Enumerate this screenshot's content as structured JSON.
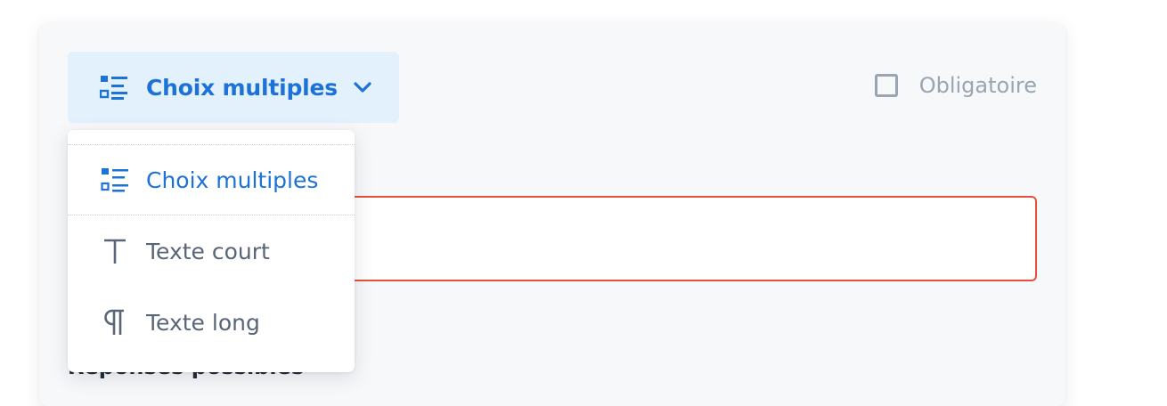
{
  "question_type": {
    "selected_label": "Choix multiples",
    "selected_icon": "list-icon",
    "options": [
      {
        "label": "Choix multiples",
        "icon": "list-icon",
        "active": true
      },
      {
        "label": "Texte court",
        "icon": "text-t-icon",
        "active": false
      },
      {
        "label": "Texte long",
        "icon": "pilcrow-icon",
        "active": false
      }
    ]
  },
  "required": {
    "label": "Obligatoire",
    "checked": false
  },
  "question_input": {
    "value": "",
    "state": "error"
  },
  "answers_section": {
    "label": "Réponses possibles"
  },
  "colors": {
    "accent": "#1d72d8",
    "accent_bg": "#e3f1fd",
    "error_border": "#e5513c",
    "muted": "#9aa5b1",
    "option_text": "#5a6577"
  }
}
